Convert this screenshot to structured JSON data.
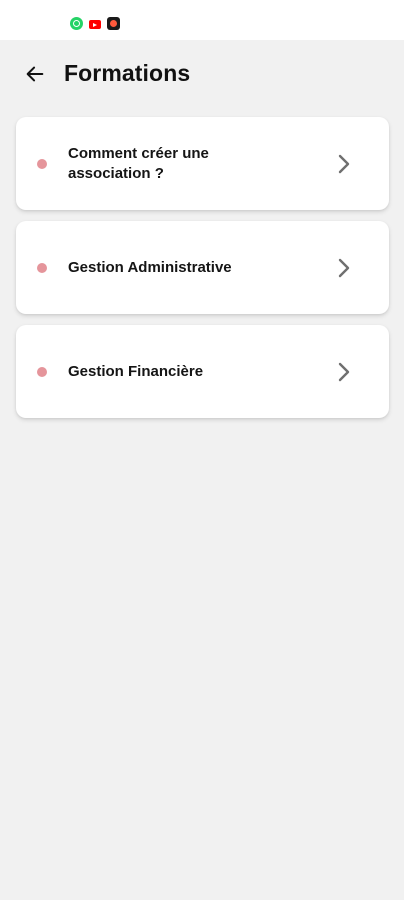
{
  "status_bar": {
    "icons": [
      "whatsapp-icon",
      "youtube-icon",
      "app-notification-icon"
    ]
  },
  "header": {
    "back_icon": "arrow-left-icon",
    "title": "Formations"
  },
  "formations": [
    {
      "label": "Comment créer une association ?",
      "chevron_icon": "chevron-right-icon"
    },
    {
      "label": "Gestion Administrative",
      "chevron_icon": "chevron-right-icon"
    },
    {
      "label": "Gestion Financière",
      "chevron_icon": "chevron-right-icon"
    }
  ],
  "colors": {
    "background": "#f1f1f1",
    "card": "#ffffff",
    "bullet": "#e5959b",
    "text": "#151515",
    "chevron": "#6f6f6f"
  }
}
